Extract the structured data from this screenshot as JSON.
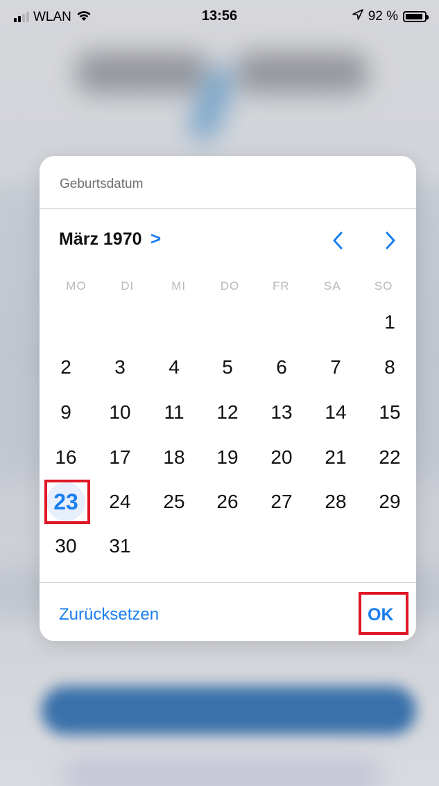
{
  "status_bar": {
    "carrier": "WLAN",
    "time": "13:56",
    "battery": "92 %",
    "signal_bars_active": 2
  },
  "dialog": {
    "title": "Geburtsdatum",
    "month_label": "März 1970",
    "month_chevron": ">",
    "weekdays": [
      "MO",
      "DI",
      "MI",
      "DO",
      "FR",
      "SA",
      "SO"
    ],
    "leading_blanks": 6,
    "days": [
      "1",
      "2",
      "3",
      "4",
      "5",
      "6",
      "7",
      "8",
      "9",
      "10",
      "11",
      "12",
      "13",
      "14",
      "15",
      "16",
      "17",
      "18",
      "19",
      "20",
      "21",
      "22",
      "23",
      "24",
      "25",
      "26",
      "27",
      "28",
      "29",
      "30",
      "31"
    ],
    "selected_day": "23",
    "reset_label": "Zurücksetzen",
    "ok_label": "OK"
  },
  "colors": {
    "accent": "#1a7ef0",
    "highlight": "#e01726"
  },
  "icons": {
    "prev": "chevron-left-icon",
    "next": "chevron-right-icon",
    "wifi": "wifi-icon",
    "location": "location-arrow-icon",
    "battery": "battery-icon"
  }
}
